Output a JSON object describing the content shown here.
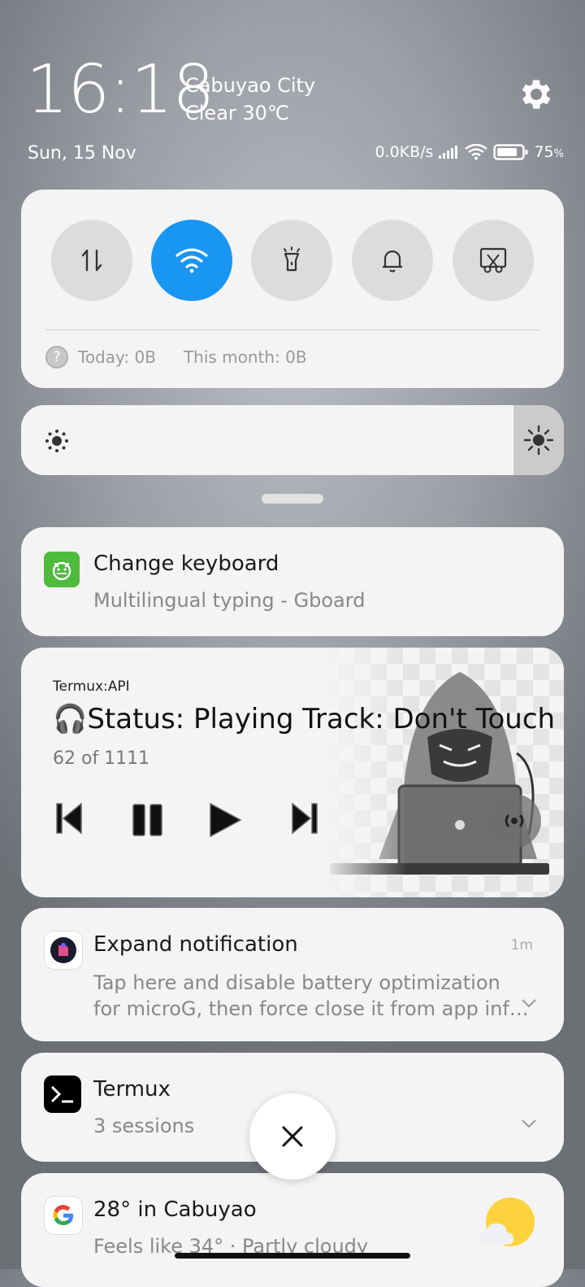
{
  "header": {
    "time": "16:18",
    "city": "Cabuyao City",
    "weather": "Clear 30℃",
    "date": "Sun, 15 Nov",
    "net_speed": "0.0KB/s",
    "battery": "75"
  },
  "quick_settings": {
    "toggles": [
      {
        "name": "mobile-data",
        "on": false
      },
      {
        "name": "wifi",
        "on": true
      },
      {
        "name": "flashlight",
        "on": false
      },
      {
        "name": "sound",
        "on": false
      },
      {
        "name": "screenshot",
        "on": false
      }
    ],
    "today_usage": "Today: 0B",
    "month_usage": "This month: 0B"
  },
  "notifications": {
    "keyboard": {
      "title": "Change keyboard",
      "subtitle": "Multilingual typing - Gboard"
    },
    "media": {
      "app": "Termux:API",
      "title": "🎧Status: Playing Track: Don't Touch ..",
      "counter": "62 of 1111"
    },
    "microg": {
      "title": "Expand notification",
      "time": "1m",
      "line1": "Tap here and disable battery optimization",
      "line2": "for microG, then force close it from app inf…"
    },
    "termux": {
      "title": "Termux",
      "subtitle": "3 sessions"
    },
    "google": {
      "title": "28° in Cabuyao",
      "subtitle": "Feels like 34° · Partly cloudy"
    }
  },
  "colors": {
    "accent": "#1995f2",
    "gboard": "#4fba3c"
  }
}
